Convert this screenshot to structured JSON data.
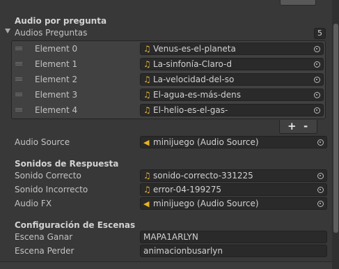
{
  "audio_section": {
    "header": "Audio por pregunta",
    "list_label": "Audios Preguntas",
    "count": "5",
    "elements": [
      {
        "label": "Element 0",
        "value": "Venus-es-el-planeta"
      },
      {
        "label": "Element 1",
        "value": "La-sinfonía-Claro-d"
      },
      {
        "label": "Element 2",
        "value": "La-velocidad-del-so"
      },
      {
        "label": "Element 3",
        "value": "El-agua-es-más-dens"
      },
      {
        "label": "Element 4",
        "value": "El-helio-es-el-gas-"
      }
    ],
    "add_label": "+",
    "remove_label": "-",
    "audio_source_label": "Audio Source",
    "audio_source_value": "minijuego (Audio Source)"
  },
  "response_section": {
    "header": "Sonidos de Respuesta",
    "correct_label": "Sonido Correcto",
    "correct_value": "sonido-correcto-331225",
    "incorrect_label": "Sonido Incorrecto",
    "incorrect_value": "error-04-199275",
    "fx_label": "Audio FX",
    "fx_value": "minijuego (Audio Source)"
  },
  "scenes_section": {
    "header": "Configuración de Escenas",
    "win_label": "Escena Ganar",
    "win_value": "MAPA1ARLYN",
    "lose_label": "Escena Perder",
    "lose_value": "animacionbusarlyn"
  },
  "icons": {
    "audio_clip": "music-note-icon",
    "audio_source": "speaker-icon",
    "object_picker": "object-picker-icon",
    "foldout": "triangle-down-icon",
    "drag_handle": "drag-handle-icon"
  },
  "colors": {
    "background": "#383838",
    "field": "#2a2a2a",
    "audio_clip_icon": "#e2b43a"
  }
}
